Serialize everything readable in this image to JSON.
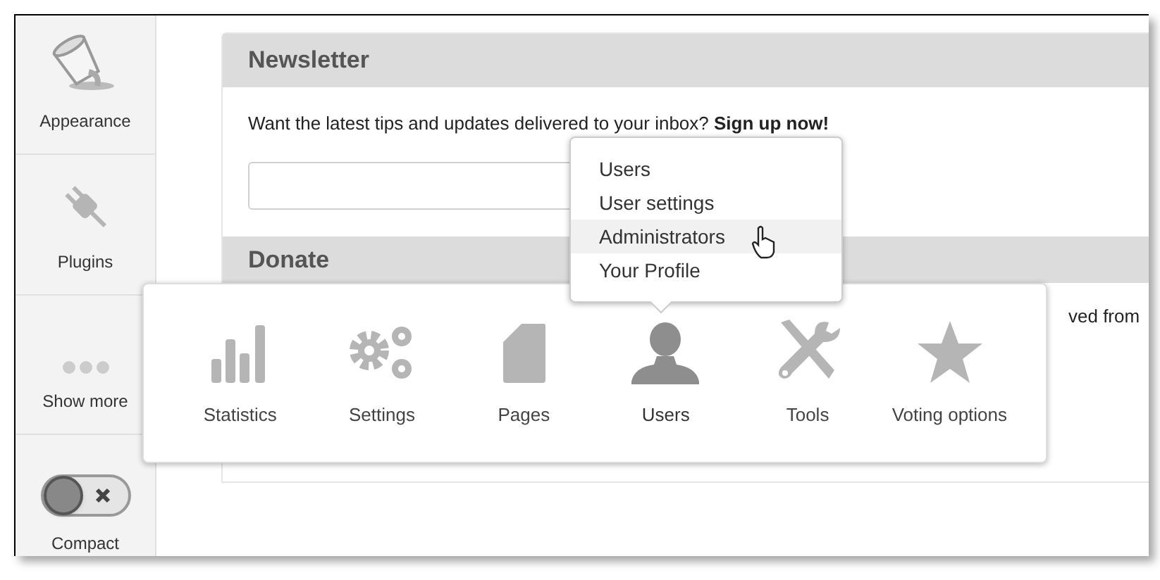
{
  "sidebar": {
    "items": [
      {
        "label": "Appearance",
        "kind": "paint"
      },
      {
        "label": "Plugins",
        "kind": "plug"
      },
      {
        "label": "Show more",
        "kind": "more"
      }
    ],
    "compact": {
      "label": "Compact",
      "on": false
    }
  },
  "newsletter": {
    "title": "Newsletter",
    "text": "Want the latest tips and updates delivered to your inbox? **Sign up now!**"
  },
  "donate": {
    "title": "Donate",
    "text": "ved from"
  },
  "menu_panel": {
    "items": [
      {
        "label": "Statistics",
        "kind": "stats",
        "selected": false
      },
      {
        "label": "Settings",
        "kind": "gears",
        "selected": false
      },
      {
        "label": "Pages",
        "kind": "page",
        "selected": false
      },
      {
        "label": "Users",
        "kind": "user",
        "selected": true
      },
      {
        "label": "Tools",
        "kind": "tools",
        "selected": false
      },
      {
        "label": "Voting options",
        "kind": "star",
        "selected": false
      }
    ]
  },
  "submenu": {
    "items": [
      {
        "label": "Users",
        "selected": false
      },
      {
        "label": "User settings",
        "selected": false
      },
      {
        "label": "Administrators",
        "selected": true
      },
      {
        "label": "Your Profile",
        "selected": false
      }
    ]
  }
}
